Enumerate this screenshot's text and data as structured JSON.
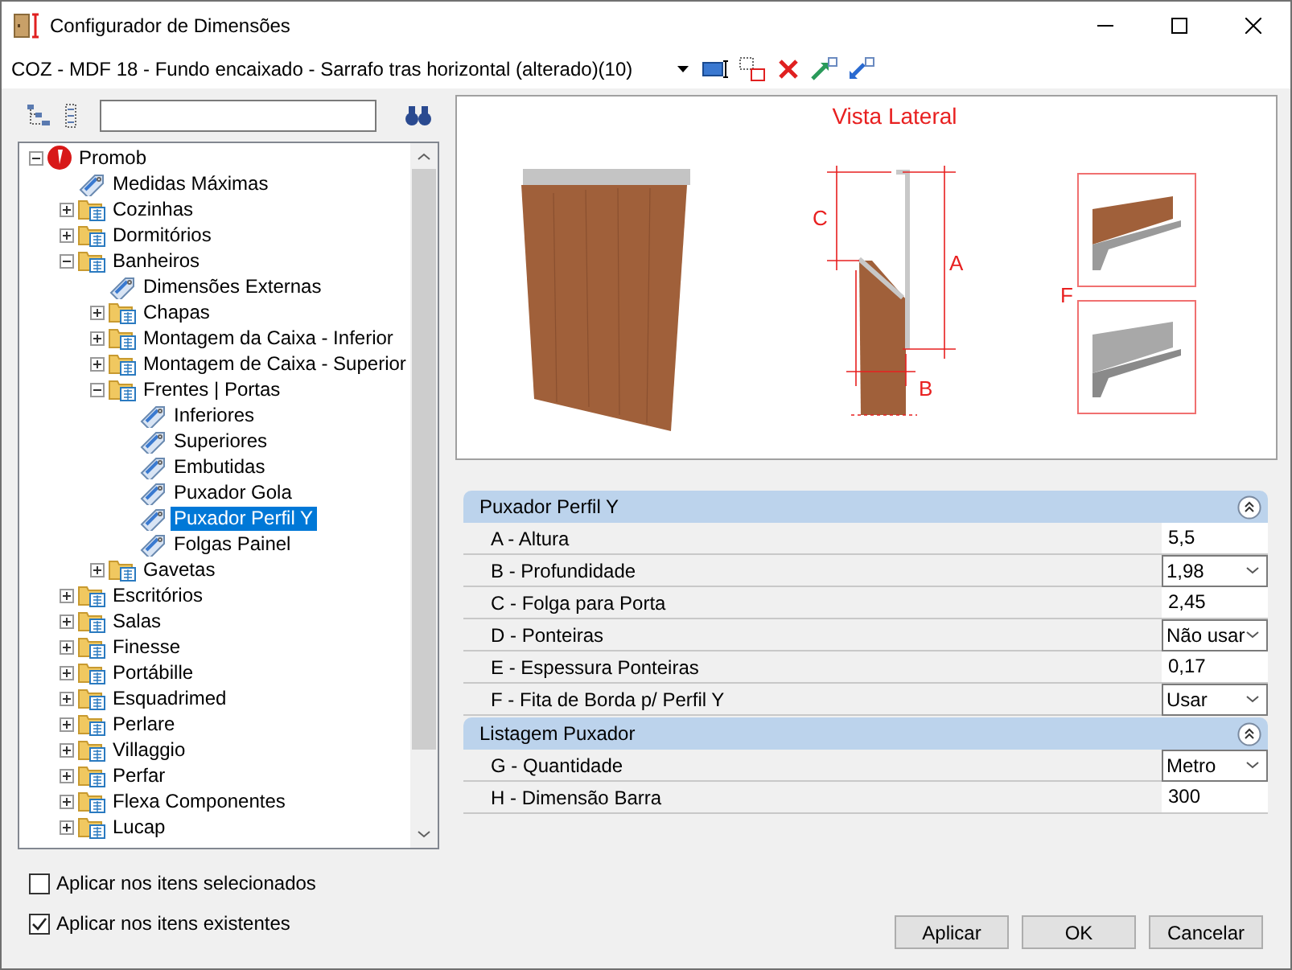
{
  "window": {
    "title": "Configurador de Dimensões"
  },
  "toolbar": {
    "combo_value": "COZ - MDF 18 - Fundo encaixado - Sarrafo tras horizontal (alterado)(10)"
  },
  "tree": [
    {
      "label": "Promob",
      "kind": "root",
      "expanded": true,
      "selected": false,
      "children": [
        {
          "label": "Medidas Máximas",
          "kind": "tag",
          "selected": false
        },
        {
          "label": "Cozinhas",
          "kind": "folder",
          "expanded": false,
          "selected": false
        },
        {
          "label": "Dormitórios",
          "kind": "folder",
          "expanded": false,
          "selected": false
        },
        {
          "label": "Banheiros",
          "kind": "folder",
          "expanded": true,
          "selected": false,
          "children": [
            {
              "label": "Dimensões Externas",
              "kind": "tag",
              "selected": false
            },
            {
              "label": "Chapas",
              "kind": "folder",
              "expanded": false,
              "selected": false
            },
            {
              "label": "Montagem da Caixa - Inferior",
              "kind": "folder",
              "expanded": false,
              "selected": false
            },
            {
              "label": "Montagem de Caixa - Superior",
              "kind": "folder",
              "expanded": false,
              "selected": false
            },
            {
              "label": "Frentes | Portas",
              "kind": "folder",
              "expanded": true,
              "selected": false,
              "children": [
                {
                  "label": "Inferiores",
                  "kind": "tag",
                  "selected": false
                },
                {
                  "label": "Superiores",
                  "kind": "tag",
                  "selected": false
                },
                {
                  "label": "Embutidas",
                  "kind": "tag",
                  "selected": false
                },
                {
                  "label": "Puxador Gola",
                  "kind": "tag",
                  "selected": false
                },
                {
                  "label": "Puxador Perfil Y",
                  "kind": "tag",
                  "selected": true
                },
                {
                  "label": "Folgas Painel",
                  "kind": "tag",
                  "selected": false
                }
              ]
            },
            {
              "label": "Gavetas",
              "kind": "folder",
              "expanded": false,
              "selected": false
            }
          ]
        },
        {
          "label": "Escritórios",
          "kind": "folder",
          "expanded": false,
          "selected": false
        },
        {
          "label": "Salas",
          "kind": "folder",
          "expanded": false,
          "selected": false
        },
        {
          "label": "Finesse",
          "kind": "folder",
          "expanded": false,
          "selected": false
        },
        {
          "label": "Portábille",
          "kind": "folder",
          "expanded": false,
          "selected": false
        },
        {
          "label": "Esquadrimed",
          "kind": "folder",
          "expanded": false,
          "selected": false
        },
        {
          "label": "Perlare",
          "kind": "folder",
          "expanded": false,
          "selected": false
        },
        {
          "label": "Villaggio",
          "kind": "folder",
          "expanded": false,
          "selected": false
        },
        {
          "label": "Perfar",
          "kind": "folder",
          "expanded": false,
          "selected": false
        },
        {
          "label": "Flexa Componentes",
          "kind": "folder",
          "expanded": false,
          "selected": false
        },
        {
          "label": "Lucap",
          "kind": "folder",
          "expanded": false,
          "selected": false
        }
      ]
    }
  ],
  "preview": {
    "title": "Vista Lateral",
    "labels": {
      "a": "A",
      "b": "B",
      "c": "C",
      "f": "F"
    }
  },
  "sections": [
    {
      "title": "Puxador Perfil Y",
      "expanded": true,
      "rows": [
        {
          "label": "A - Altura",
          "kind": "text",
          "value": "5,5"
        },
        {
          "label": "B - Profundidade",
          "kind": "select",
          "value": "1,98"
        },
        {
          "label": "C - Folga para Porta",
          "kind": "text",
          "value": "2,45"
        },
        {
          "label": "D - Ponteiras",
          "kind": "select",
          "value": "Não usar"
        },
        {
          "label": "E - Espessura Ponteiras",
          "kind": "text",
          "value": "0,17"
        },
        {
          "label": "F - Fita de Borda p/ Perfil Y",
          "kind": "select",
          "value": "Usar"
        }
      ]
    },
    {
      "title": "Listagem Puxador",
      "expanded": true,
      "rows": [
        {
          "label": "G - Quantidade",
          "kind": "select",
          "value": "Metro"
        },
        {
          "label": "H - Dimensão Barra",
          "kind": "text",
          "value": "300"
        }
      ]
    }
  ],
  "options": [
    {
      "label": "Aplicar nos itens selecionados",
      "checked": false
    },
    {
      "label": "Aplicar nos itens existentes",
      "checked": true
    }
  ],
  "buttons": [
    "Aplicar",
    "OK",
    "Cancelar"
  ]
}
